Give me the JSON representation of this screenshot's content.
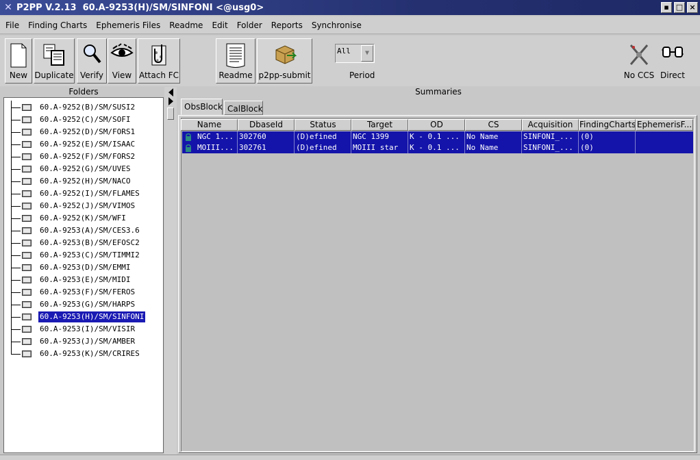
{
  "window": {
    "title": "P2PP V.2.13  60.A-9253(H)/SM/SINFONI <@usg0>",
    "controls": [
      "▪",
      "□",
      "×"
    ]
  },
  "menu": [
    "File",
    "Finding Charts",
    "Ephemeris Files",
    "Readme",
    "Edit",
    "Folder",
    "Reports",
    "Synchronise"
  ],
  "toolbar": {
    "buttons": [
      "New",
      "Duplicate",
      "Verify",
      "View",
      "Attach FC",
      "Readme",
      "p2pp-submit"
    ],
    "period": {
      "selected": "All",
      "label": "Period"
    },
    "right": {
      "no_ccs": "No CCS",
      "direct": "Direct"
    }
  },
  "folders": {
    "header": "Folders",
    "items": [
      "60.A-9252(B)/SM/SUSI2",
      "60.A-9252(C)/SM/SOFI",
      "60.A-9252(D)/SM/FORS1",
      "60.A-9252(E)/SM/ISAAC",
      "60.A-9252(F)/SM/FORS2",
      "60.A-9252(G)/SM/UVES",
      "60.A-9252(H)/SM/NACO",
      "60.A-9252(I)/SM/FLAMES",
      "60.A-9252(J)/SM/VIMOS",
      "60.A-9252(K)/SM/WFI",
      "60.A-9253(A)/SM/CES3.6",
      "60.A-9253(B)/SM/EFOSC2",
      "60.A-9253(C)/SM/TIMMI2",
      "60.A-9253(D)/SM/EMMI",
      "60.A-9253(E)/SM/MIDI",
      "60.A-9253(F)/SM/FEROS",
      "60.A-9253(G)/SM/HARPS",
      "60.A-9253(H)/SM/SINFONI",
      "60.A-9253(I)/SM/VISIR",
      "60.A-9253(J)/SM/AMBER",
      "60.A-9253(K)/SM/CRIRES"
    ],
    "selected_index": 17
  },
  "summaries": {
    "header": "Summaries",
    "tabs": [
      "ObsBlock",
      "CalBlock"
    ],
    "columns": [
      "Name",
      "DbaseId",
      "Status",
      "Target",
      "OD",
      "CS",
      "Acquisition",
      "FindingCharts",
      "EphemerisF..."
    ],
    "rows": [
      [
        "NGC 1...",
        "302760",
        "(D)efined",
        "NGC 1399",
        "K - 0.1 ...",
        "No Name",
        "SINFONI_...",
        "(0)",
        ""
      ],
      [
        "MOIII...",
        "302761",
        "(D)efined",
        "MOIII star",
        "K - 0.1 ...",
        "No Name",
        "SINFONI_...",
        "(0)",
        ""
      ]
    ]
  }
}
